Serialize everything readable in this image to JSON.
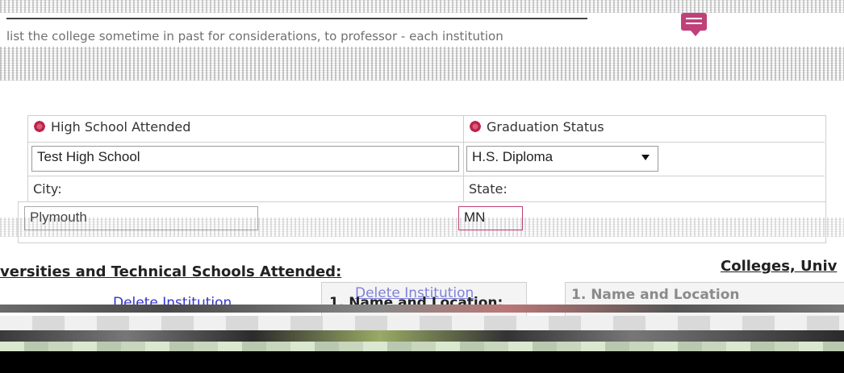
{
  "instructions": {
    "line1": "list the college sometime in past for considerations, to professor - each institution",
    "line2": "..."
  },
  "form": {
    "high_school": {
      "label": "High School Attended",
      "value": "Test High School"
    },
    "graduation_status": {
      "label": "Graduation Status",
      "value": "H.S. Diploma"
    },
    "city": {
      "label": "City:",
      "value": "Plymouth"
    },
    "state": {
      "label": "State:",
      "value": "MN"
    }
  },
  "colleges": {
    "left_title": "versities and Technical Schools Attended:",
    "right_title": "Colleges, Univ",
    "delete_link": "Delete Institution",
    "delete_link_top": "Delete Institution",
    "name_location": "1. Name and Location:",
    "name_location_right": "1. Name and Location"
  },
  "colors": {
    "required_marker": "#b8244a",
    "chat_icon": "#c0407a",
    "link": "#3333cc",
    "border": "#cfcfcf"
  }
}
